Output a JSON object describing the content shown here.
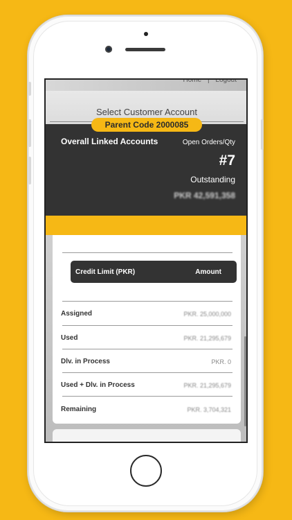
{
  "top_links": {
    "home": "Home",
    "separator": "|",
    "logout": "Logout"
  },
  "select_account": {
    "placeholder": "Select Customer Account"
  },
  "parent_code": "Parent Code 2000085",
  "summary": {
    "title": "Overall Linked Accounts",
    "orders_label": "Open Orders/Qty",
    "orders_value": "#7",
    "outstanding_label": "Outstanding",
    "outstanding_value": "PKR 42,591,358"
  },
  "credit_table": {
    "header_left": "Credit Limit (PKR)",
    "header_right": "Amount",
    "rows": [
      {
        "label": "Assigned",
        "value": "PKR. 25,000,000"
      },
      {
        "label": "Used",
        "value": "PKR. 21,295,679"
      },
      {
        "label": "Dlv. in Process",
        "value": "PKR. 0"
      },
      {
        "label": "Used + Dlv. in Process",
        "value": "PKR. 21,295,679"
      },
      {
        "label": "Remaining",
        "value": "PKR. 3,704,321"
      }
    ]
  },
  "colors": {
    "background": "#F6B815",
    "dark_card": "#333333",
    "accent": "#F6B815"
  }
}
